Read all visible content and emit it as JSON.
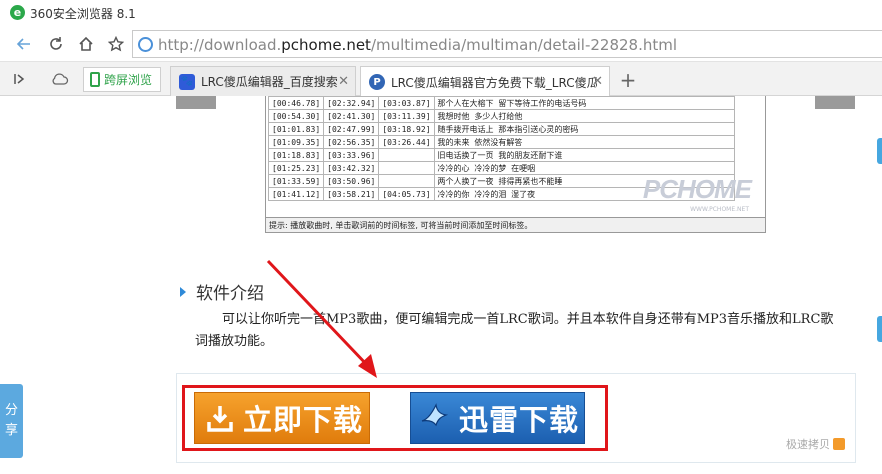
{
  "window": {
    "title": "360安全浏览器 8.1",
    "logo_glyph": "e"
  },
  "address": {
    "url_prefix": "http://download.",
    "url_domain": "pchome.net",
    "url_suffix": "/multimedia/multiman/detail-22828.html"
  },
  "toolbar": {
    "split_screen": "跨屏浏览"
  },
  "tabs": [
    {
      "label": "LRC傻瓜编辑器_百度搜索",
      "icon": "baidu-paw-icon",
      "active": false
    },
    {
      "label": "LRC傻瓜编辑器官方免费下载_LRC傻瓜",
      "icon": "pchome-p-icon",
      "active": true
    }
  ],
  "lrc_table": [
    [
      "[00:46.78]",
      "[02:32.94]",
      "[03:03.87]",
      "那个人在大榕下  留下等待工作的电话号码"
    ],
    [
      "[00:54.30]",
      "[02:41.30]",
      "[03:11.39]",
      "我想时他  多少人打给他"
    ],
    [
      "[01:01.83]",
      "[02:47.99]",
      "[03:18.92]",
      "随手拨开电话上  那本指引送心灵的密码"
    ],
    [
      "[01:09.35]",
      "[02:56.35]",
      "[03:26.44]",
      "我的未来  依然没有解答"
    ],
    [
      "[01:18.83]",
      "[03:33.96]",
      "",
      "旧电话换了一页  我的朋友还耐下谁"
    ],
    [
      "[01:25.23]",
      "[03:42.32]",
      "",
      "冷冷的心  冷冷的梦  在哽咽"
    ],
    [
      "[01:33.59]",
      "[03:50.96]",
      "",
      "两个人换了一夜  排得再紧也不能睡"
    ],
    [
      "[01:41.12]",
      "[03:58.21]",
      "[04:05.73]",
      "冷冷的你  冷冷的泪  湿了夜"
    ]
  ],
  "lrc_status": "提示: 播放歌曲时, 单击歌词前的时间标签, 可将当前时间添加至时间标签。",
  "watermark": {
    "logo": "PCHOME",
    "site": "WWW.PCHOME.NET"
  },
  "intro": {
    "heading": "软件介绍",
    "body": "可以让你听完一首MP3歌曲，便可编辑完成一首LRC歌词。并且本软件自身还带有MP3音乐播放和LRC歌词播放功能。"
  },
  "download": {
    "now_label": "立即下载",
    "xunlei_label": "迅雷下载",
    "fast_copy": "极速拷贝"
  },
  "share": {
    "line1": "分",
    "line2": "享"
  },
  "colors": {
    "orange_button": "#e88a14",
    "blue_button": "#2a74c6",
    "red_highlight": "#e0161a",
    "accent_blue": "#2f8ad8"
  }
}
